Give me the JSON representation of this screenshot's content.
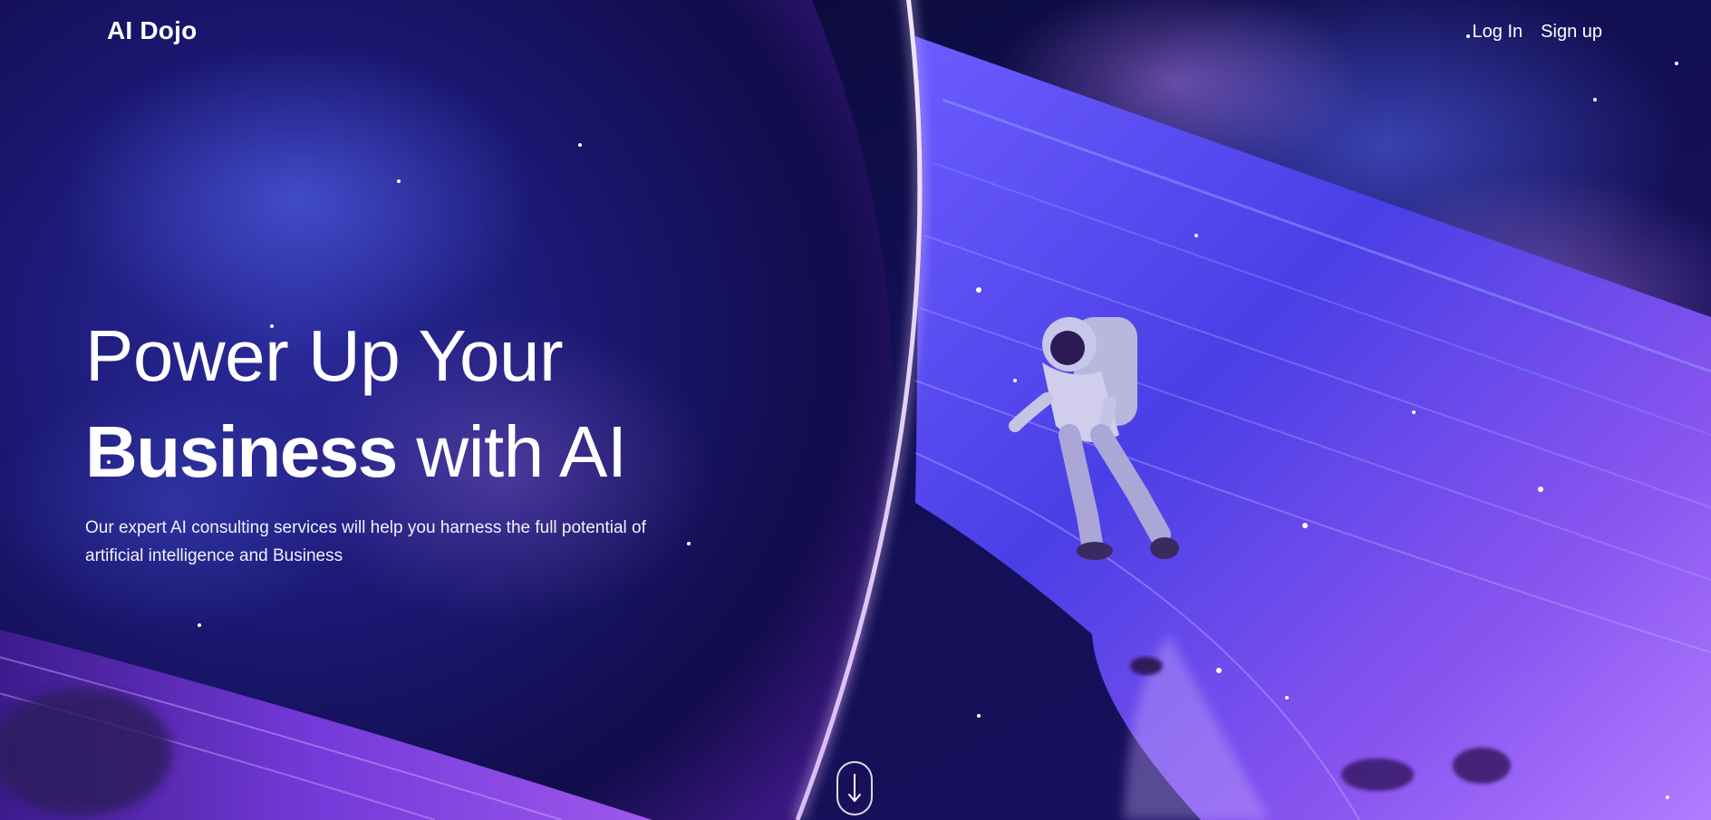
{
  "brand": {
    "name": "AI Dojo"
  },
  "nav": {
    "login_label": "Log In",
    "signup_label": "Sign up"
  },
  "hero": {
    "headline_line1": "Power Up Your",
    "headline_strong": "Business",
    "headline_rest": " with AI",
    "subtext": "Our expert AI consulting services will help you harness the full potential of artificial intelligence and Business"
  },
  "scroll": {
    "icon": "arrow-down-icon"
  },
  "colors": {
    "deep_space": "#0a0830",
    "violet": "#5b2bd6",
    "glow": "#b48cff",
    "text": "#ffffff"
  }
}
